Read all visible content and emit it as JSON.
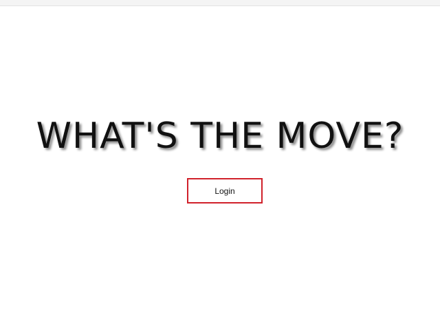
{
  "hero": {
    "title": "WHAT'S THE MOVE?"
  },
  "actions": {
    "login_label": "Login"
  },
  "colors": {
    "background": "#ffffff",
    "title_text": "#111111",
    "login_border": "#d0202a"
  }
}
